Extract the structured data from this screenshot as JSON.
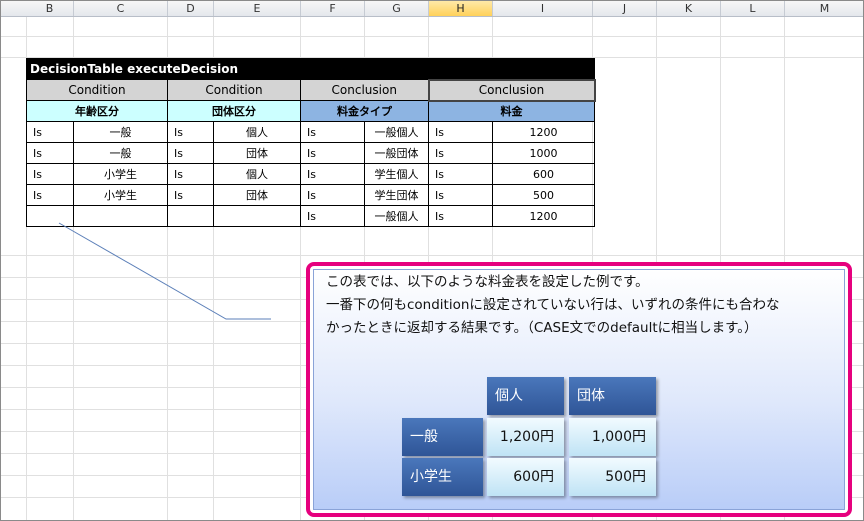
{
  "columns": [
    "B",
    "C",
    "D",
    "E",
    "F",
    "G",
    "H",
    "I",
    "J",
    "K",
    "L",
    "M"
  ],
  "selected_column": "H",
  "decision_table": {
    "title": "DecisionTable executeDecision",
    "kinds": [
      "Condition",
      "Condition",
      "Conclusion",
      "Conclusion"
    ],
    "names": [
      "年齢区分",
      "団体区分",
      "料金タイプ",
      "料金"
    ],
    "rows": [
      [
        "Is",
        "一般",
        "Is",
        "個人",
        "Is",
        "一般個人",
        "Is",
        "1200"
      ],
      [
        "Is",
        "一般",
        "Is",
        "団体",
        "Is",
        "一般団体",
        "Is",
        "1000"
      ],
      [
        "Is",
        "小学生",
        "Is",
        "個人",
        "Is",
        "学生個人",
        "Is",
        "600"
      ],
      [
        "Is",
        "小学生",
        "Is",
        "団体",
        "Is",
        "学生団体",
        "Is",
        "500"
      ],
      [
        "",
        "",
        "",
        "",
        "Is",
        "一般個人",
        "Is",
        "1200"
      ]
    ]
  },
  "callout": {
    "line1": "この表では、以下のような料金表を設定した例です。",
    "line2": "一番下の何もconditionに設定されていない行は、いずれの条件にも合わな",
    "line3": "かったときに返却する結果です。（CASE文でのdefaultに相当します。）",
    "border_color": "#e6007e"
  },
  "price_table": {
    "col_headers": [
      "個人",
      "団体"
    ],
    "row_headers": [
      "一般",
      "小学生"
    ],
    "values": [
      [
        "1,200円",
        "1,000円"
      ],
      [
        "600円",
        "500円"
      ]
    ]
  }
}
